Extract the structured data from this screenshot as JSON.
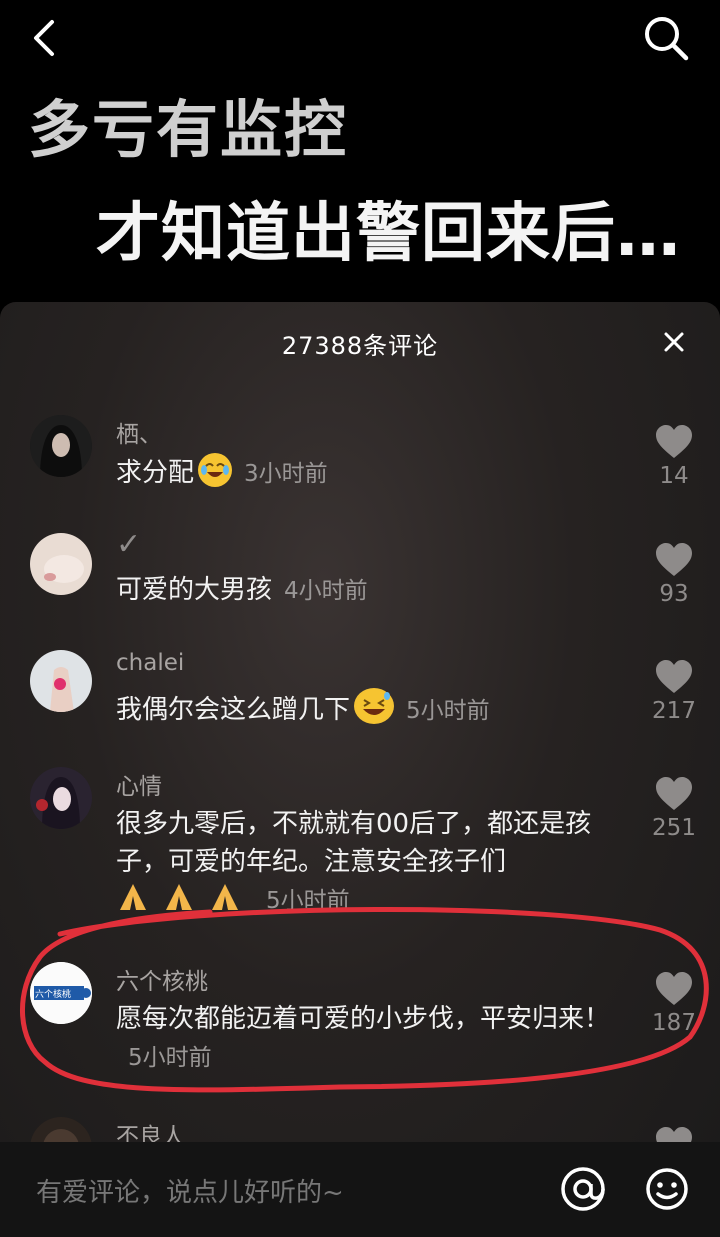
{
  "video": {
    "title_line1": "多亏有监控",
    "title_line2": "才知道出警回来后…"
  },
  "comments_panel": {
    "count_label": "27388条评论"
  },
  "comments": [
    {
      "user": "栖、",
      "text": "求分配",
      "emoji": "crying-laughing-emoji",
      "time": "3小时前",
      "likes": "14"
    },
    {
      "user": "✓",
      "text": "可爱的大男孩",
      "time": "4小时前",
      "likes": "93"
    },
    {
      "user": "chalei",
      "text": "我偶尔会这么蹭几下",
      "emoji": "grinning-sweat-emoji",
      "time": "5小时前",
      "likes": "217"
    },
    {
      "user": "心情",
      "text": "很多九零后，不就就有00后了，都还是孩子，可爱的年纪。注意安全孩子们",
      "emoji": "praying-hands-emoji ×3",
      "time": "5小时前",
      "likes": "251"
    },
    {
      "user": "六个核桃",
      "avatar_text": "六个核桃",
      "text": "愿每次都能迈着可爱的小步伐，平安归来！",
      "time": "5小时前",
      "likes": "187"
    },
    {
      "user": "不良人"
    }
  ],
  "input": {
    "placeholder": "有爱评论，说点儿好听的~"
  },
  "colors": {
    "annotation_circle": "#e0303a",
    "panel_background": "#262221"
  }
}
